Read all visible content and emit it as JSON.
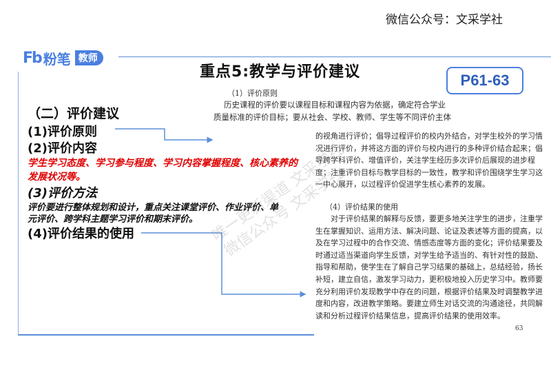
{
  "header": {
    "watermark_account": "微信公众号：文采学社"
  },
  "logo": {
    "brand": "粉笔",
    "tag": "教师",
    "mark": "Fb"
  },
  "slide": {
    "title": "重点5:教学与评价建议",
    "page_ref": "P61-63"
  },
  "left": {
    "heading": "（二）评价建议",
    "item1": "(1)评价原则",
    "item2": "(2)评价内容",
    "item2_detail": [
      "学生学习态度、学习参与程度、学习内容掌握程度、核心素养的",
      "发展状况等。"
    ],
    "item3": "(3)评价方法",
    "item3_detail": [
      "评价要进行整体规划和设计，重点关注课堂评价、作业评价、单",
      "元评价、跨学科主题学习评价和期末评价。"
    ],
    "item4": "(4)评价结果的使用"
  },
  "excerpt": {
    "sec1_title": "（1）评价原则",
    "sec1_lines": [
      "历史课程的评价要以课程目标和课程内容为依据，确定符合学业",
      "质量标准的评价目标；要从社会、学校、教师、学生等不同评价主体",
      "的视角进行评价；倡导过程评价的校内外结合，对学生校外的学习情",
      "况进行评价，并将这方面的评价与校内进行的多种评价结合起来；倡",
      "导跨学科评价、增值评价，关注学生经历多次评价后展现的进步程",
      "度；注重评价目标与教学目标的一致性，教学和评价围绕学生学习这",
      "一中心展开，以过程评价促进学生核心素养的发展。"
    ],
    "sec4_title": "（4）评价结果的使用",
    "sec4_lines": [
      "对于评价结果的解释与反馈，要更多地关注学生的进步，注重学",
      "生在掌握知识、运用方法、解决问题、论证及表述等方面的提高，以",
      "及在学习过程中的合作交流、情感态度等方面的变化；评价结果要及",
      "时通过适当渠道向学生反馈，对学生给予适当的、有针对性的鼓励、",
      "指导和帮助，使学生在了解自己学习结果的基础上，总结经验，扬长",
      "补短，建立自信，激发学习动力，更积极地投入历史学习中。教师要",
      "充分利用评价发现教学中存在的问题，根据评价结果及时调整教学进",
      "度和内容，改进教学策略。要建立师生对话交流的沟通途径，共同解",
      "读和分析过程评价结果信息，提高评价结果的使用效率。"
    ],
    "page_number": "63"
  },
  "watermarks": [
    "唯一更新渠道 文采学社",
    "微信公众号 文采学社"
  ],
  "colors": {
    "accent": "#4a7fe0",
    "red": "#e00000"
  }
}
